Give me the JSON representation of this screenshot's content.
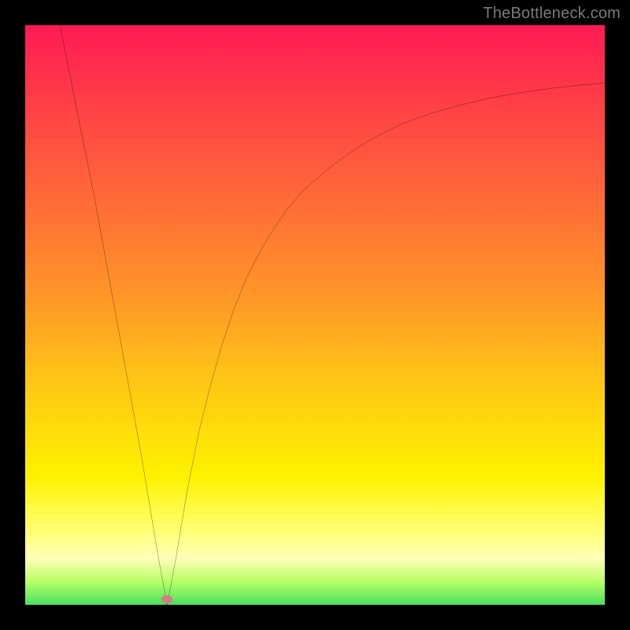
{
  "watermark": {
    "text": "TheBottleneck.com"
  },
  "colors": {
    "frame": "#000000",
    "curve": "#000000",
    "marker": "#d97b84",
    "gradient_stops": [
      {
        "pct": 0,
        "hex": "#ff1a55"
      },
      {
        "pct": 12,
        "hex": "#ff3b47"
      },
      {
        "pct": 30,
        "hex": "#ff6a38"
      },
      {
        "pct": 48,
        "hex": "#ff9a26"
      },
      {
        "pct": 62,
        "hex": "#ffc814"
      },
      {
        "pct": 78,
        "hex": "#fff200"
      },
      {
        "pct": 87,
        "hex": "#ffff70"
      },
      {
        "pct": 92,
        "hex": "#ffffb8"
      },
      {
        "pct": 96,
        "hex": "#b7ff66"
      },
      {
        "pct": 100,
        "hex": "#49e060"
      }
    ]
  },
  "chart_data": {
    "type": "line",
    "title": "",
    "xlabel": "",
    "ylabel": "",
    "xrange": [
      0,
      100
    ],
    "yrange": [
      0,
      100
    ],
    "minimum": {
      "x": 24.5,
      "y": 0
    },
    "left_start": {
      "x": 6,
      "y": 100
    },
    "right_end": {
      "x": 100,
      "y": 90
    },
    "series": [
      {
        "name": "curve",
        "x": [
          6,
          8,
          10,
          12,
          14,
          16,
          18,
          20,
          22,
          23,
          24.5,
          26,
          27,
          28,
          30,
          32,
          34,
          36,
          38,
          40,
          42,
          45,
          48,
          52,
          56,
          60,
          65,
          70,
          75,
          80,
          85,
          90,
          95,
          100
        ],
        "y": [
          100,
          90,
          80,
          70,
          59,
          48,
          37,
          26,
          14,
          8,
          0,
          8,
          14,
          20,
          30,
          38,
          45,
          51,
          56,
          60,
          63.5,
          68,
          71.5,
          75,
          78,
          80.5,
          83,
          84.8,
          86.2,
          87.4,
          88.3,
          89,
          89.6,
          90
        ]
      }
    ],
    "marker": {
      "x": 24.5,
      "y": 1
    }
  }
}
